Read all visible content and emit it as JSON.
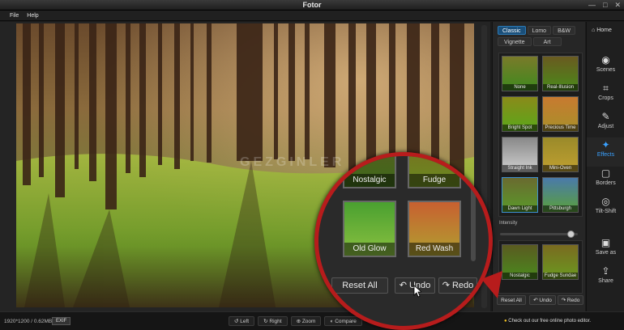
{
  "window": {
    "title": "Fotor",
    "controls": [
      "—",
      "□",
      "✕"
    ]
  },
  "menu": [
    "File",
    "Help"
  ],
  "panel": {
    "tabs_row1": [
      {
        "label": "Classic",
        "active": true
      },
      {
        "label": "Lomo",
        "active": false
      },
      {
        "label": "B&W",
        "active": false
      }
    ],
    "tabs_row2": [
      {
        "label": "Vignette",
        "active": false
      },
      {
        "label": "Art",
        "active": false
      }
    ],
    "effects": [
      {
        "label": "None",
        "selected": false
      },
      {
        "label": "Real-Illusion",
        "selected": false
      },
      {
        "label": "Bright Spot",
        "selected": false
      },
      {
        "label": "Precious Time",
        "selected": false
      },
      {
        "label": "Straight Ink",
        "selected": false
      },
      {
        "label": "Mini-Oven",
        "selected": false
      },
      {
        "label": "Dawn Light",
        "selected": true
      },
      {
        "label": "Pittsburgh",
        "selected": false
      }
    ],
    "intensity_label": "Intensity",
    "intensity_value": 0.95,
    "effects2": [
      {
        "label": "Nostalgic"
      },
      {
        "label": "Fudge Sundae"
      }
    ],
    "reset_label": "Reset All",
    "undo_label": "Undo",
    "redo_label": "Redo"
  },
  "nav": {
    "home_label": "Home",
    "items": [
      {
        "label": "Scenes",
        "icon": "camera-icon",
        "active": false
      },
      {
        "label": "Crops",
        "icon": "crop-icon",
        "active": false
      },
      {
        "label": "Adjust",
        "icon": "pencil-icon",
        "active": false
      },
      {
        "label": "Effects",
        "icon": "sparkle-icon",
        "active": true
      },
      {
        "label": "Borders",
        "icon": "frame-icon",
        "active": false
      },
      {
        "label": "Tilt-Shift",
        "icon": "tiltshift-icon",
        "active": false
      }
    ],
    "save_label": "Save as",
    "share_label": "Share"
  },
  "status": {
    "dimensions": "1920*1200 / 0.62MB",
    "exif_label": "EXIF",
    "tools": [
      "Left",
      "Right",
      "Zoom",
      "Compare"
    ],
    "promo": "Check out our free online photo editor."
  },
  "callout": {
    "top_labels": [
      "Nostalgic",
      "Fudge Sundae"
    ],
    "thumbs": [
      "Old Glow",
      "Red Wash"
    ],
    "reset_label": "Reset All",
    "undo_label": "Undo",
    "redo_label": "Redo"
  },
  "watermark": "GEZGINLER",
  "colors": {
    "accent": "#3aa1ff",
    "callout_ring": "#b71c1c",
    "active_tab": "#1a4f7a"
  }
}
